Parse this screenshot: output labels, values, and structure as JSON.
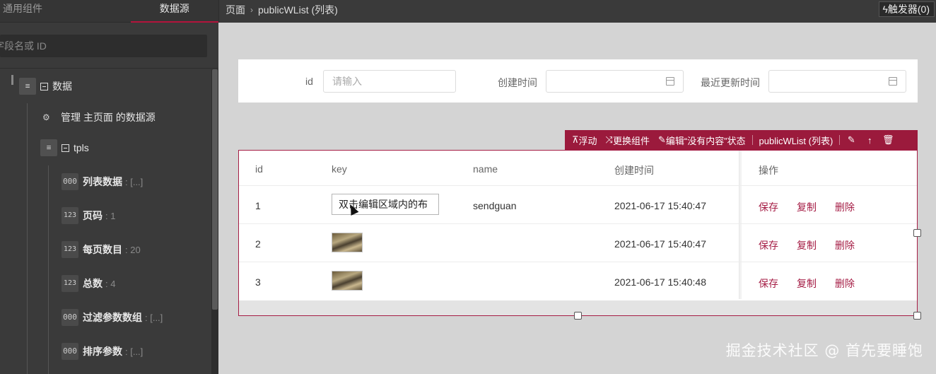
{
  "left_panel": {
    "tabs": [
      "通用组件",
      "数据源"
    ],
    "search_placeholder": "字段名或 ID",
    "tree": {
      "root_label": "数据",
      "manage_label": "管理 主页面 的数据源",
      "tpls_label": "tpls",
      "fields": [
        {
          "icon": "000",
          "label": "列表数据",
          "meta": ": [...]"
        },
        {
          "icon": "123",
          "label": "页码",
          "meta": ": 1"
        },
        {
          "icon": "123",
          "label": "每页数目",
          "meta": ": 20"
        },
        {
          "icon": "123",
          "label": "总数",
          "meta": ": 4"
        },
        {
          "icon": "000",
          "label": "过滤参数数组",
          "meta": ": [...]"
        },
        {
          "icon": "000",
          "label": "排序参数",
          "meta": ": [...]"
        }
      ]
    }
  },
  "topbar": {
    "breadcrumb": [
      "页面",
      "publicWList (列表)"
    ],
    "trigger_label": "触发器(0)"
  },
  "filter": {
    "fields": [
      {
        "label": "id",
        "placeholder": "请输入"
      },
      {
        "label": "创建时间",
        "placeholder": ""
      },
      {
        "label": "最近更新时间",
        "placeholder": ""
      }
    ]
  },
  "toolbar": {
    "float_label": "浮动",
    "swap_label": "更换组件",
    "empty_state_label": "编辑“没有内容”状态",
    "component_name": "publicWList (列表)"
  },
  "table": {
    "columns": [
      "id",
      "key",
      "name",
      "创建时间",
      "操作"
    ],
    "rows": [
      {
        "id": "1",
        "key": "双击编辑区域内的布",
        "name": "sendguan",
        "created": "2021-06-17 15:40:47"
      },
      {
        "id": "2",
        "key": "",
        "name": "",
        "created": "2021-06-17 15:40:47"
      },
      {
        "id": "3",
        "key": "",
        "name": "",
        "created": "2021-06-17 15:40:48"
      }
    ],
    "actions": [
      "保存",
      "复制",
      "删除"
    ]
  },
  "watermark": "掘金技术社区 @ 首先要睡饱",
  "colors": {
    "accent": "#9b1a3c",
    "panel": "#3a3a3a",
    "canvas": "#d4d4d4"
  }
}
